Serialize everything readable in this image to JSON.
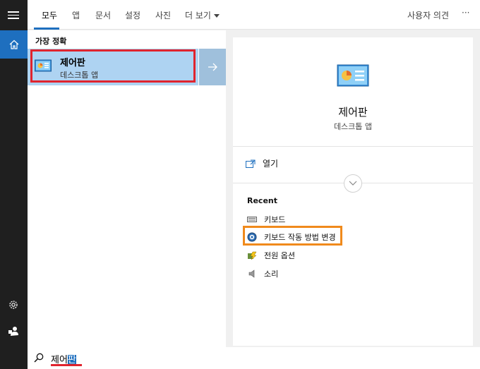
{
  "tabs": [
    {
      "label": "모두",
      "active": true
    },
    {
      "label": "앱"
    },
    {
      "label": "문서"
    },
    {
      "label": "설정"
    },
    {
      "label": "사진"
    },
    {
      "label": "더 보기"
    }
  ],
  "topbar": {
    "feedback_label": "사용자 의견",
    "more_label": "···"
  },
  "results": {
    "section_title": "가장 정확",
    "best_match": {
      "title": "제어판",
      "subtitle": "데스크톱 앱"
    }
  },
  "detail": {
    "title": "제어판",
    "subtitle": "데스크톱 앱",
    "open_label": "열기",
    "recent_title": "Recent",
    "recent_items": [
      {
        "label": "키보드",
        "icon": "keyboard-icon"
      },
      {
        "label": "키보드 작동 방법 변경",
        "icon": "ease-of-access-icon"
      },
      {
        "label": "전원 옵션",
        "icon": "power-options-icon"
      },
      {
        "label": "소리",
        "icon": "speaker-icon"
      }
    ]
  },
  "search": {
    "typed": "제어",
    "selected_suffix": "판"
  },
  "colors": {
    "accent": "#1e6fbf",
    "highlight": "#e0242e",
    "orange_highlight": "#f08a1c"
  }
}
